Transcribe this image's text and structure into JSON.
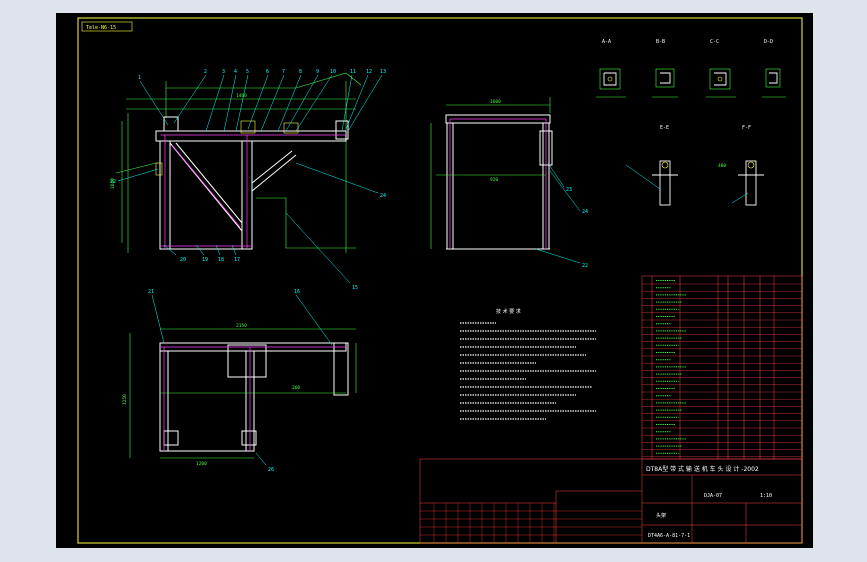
{
  "drawing": {
    "layer_tag": "Tele-N6-15",
    "notes_heading": "技 术 要 求",
    "title_line": "DT8A型 带 式 输 送 机 车 头 设 计 -2002",
    "part_label": "头架",
    "drawing_number": "DT4A6-A-81-7-1",
    "material_code": "DJA-07",
    "scale_code": "1:10",
    "upper_callouts": [
      "1",
      "2",
      "3",
      "4",
      "5",
      "6",
      "7",
      "8",
      "9",
      "10",
      "11",
      "12",
      "13"
    ],
    "left_callouts": [
      "22",
      "1",
      "24"
    ],
    "bottom_callouts": [
      "20",
      "19",
      "18",
      "17",
      "16",
      "15"
    ],
    "section_titles": [
      "A-A",
      "B-B",
      "C-C",
      "D-D",
      "E-E",
      "F-F"
    ],
    "side_view_callouts": [
      "23",
      "24",
      "22"
    ],
    "plan_view_callouts": [
      "21",
      "26"
    ],
    "dimensions": [
      "1460",
      "2640",
      "1600",
      "920",
      "2150",
      "1250",
      "260",
      "1200",
      "480"
    ]
  },
  "colors": {
    "frame": "#ffffff",
    "center_line": "#ff40ff",
    "dimension": "#40ff40",
    "outline": "#ffff40",
    "callout": "#00ffff",
    "title_block": "#ff4040"
  }
}
